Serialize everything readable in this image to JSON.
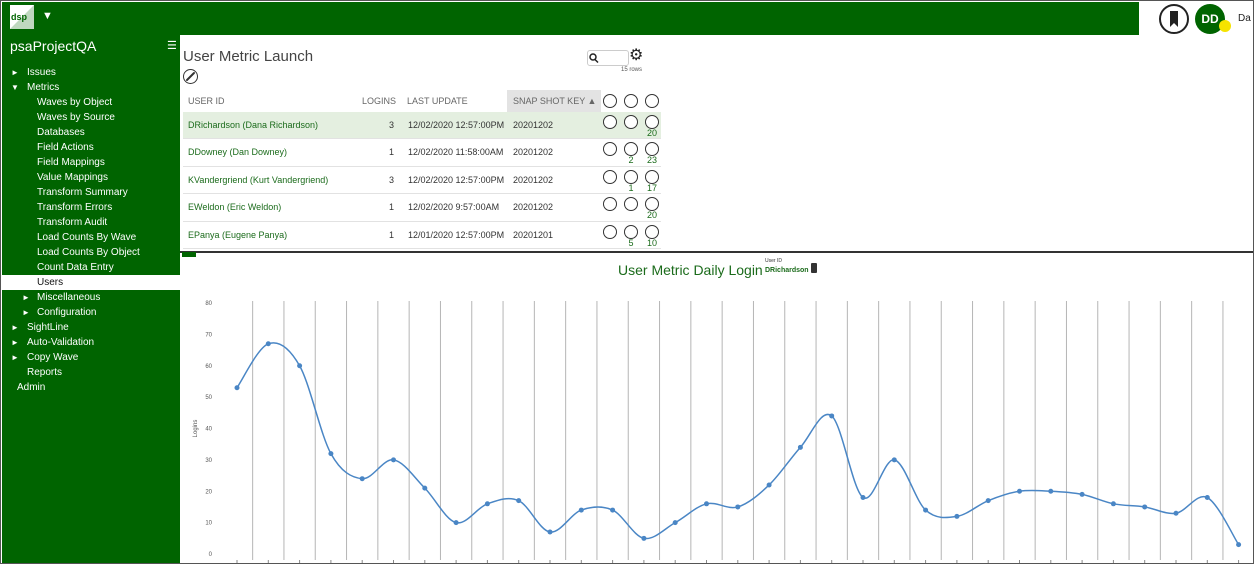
{
  "app": {
    "logo_text": "dsp",
    "user_initials": "DD",
    "user_name_short": "Da"
  },
  "sidebar": {
    "project": "psaProjectQA",
    "items": [
      {
        "label": "Issues",
        "arrow": "►",
        "level": 0
      },
      {
        "label": "Metrics",
        "arrow": "▼",
        "level": 0
      },
      {
        "label": "Waves by Object",
        "arrow": "",
        "level": 1
      },
      {
        "label": "Waves by Source",
        "arrow": "",
        "level": 1
      },
      {
        "label": "Databases",
        "arrow": "",
        "level": 1
      },
      {
        "label": "Field Actions",
        "arrow": "",
        "level": 1
      },
      {
        "label": "Field Mappings",
        "arrow": "",
        "level": 1
      },
      {
        "label": "Value Mappings",
        "arrow": "",
        "level": 1
      },
      {
        "label": "Transform Summary",
        "arrow": "",
        "level": 1
      },
      {
        "label": "Transform Errors",
        "arrow": "",
        "level": 1
      },
      {
        "label": "Transform Audit",
        "arrow": "",
        "level": 1
      },
      {
        "label": "Load Counts By Wave",
        "arrow": "",
        "level": 1
      },
      {
        "label": "Load Counts By Object",
        "arrow": "",
        "level": 1
      },
      {
        "label": "Count Data Entry",
        "arrow": "",
        "level": 1
      },
      {
        "label": "Users",
        "arrow": "",
        "level": 1,
        "active": true
      },
      {
        "label": "Miscellaneous",
        "arrow": "►",
        "level": 1
      },
      {
        "label": "Configuration",
        "arrow": "►",
        "level": 1
      },
      {
        "label": "SightLine",
        "arrow": "►",
        "level": 0
      },
      {
        "label": "Auto-Validation",
        "arrow": "►",
        "level": 0
      },
      {
        "label": "Copy Wave",
        "arrow": "►",
        "level": 0
      },
      {
        "label": "Reports",
        "arrow": "",
        "level": 0
      },
      {
        "label": "Admin",
        "arrow": "",
        "level": -1
      }
    ]
  },
  "page": {
    "title": "User Metric Launch",
    "rows_count": "15 rows"
  },
  "table": {
    "columns": {
      "user_id": "USER ID",
      "logins": "LOGINS",
      "last_update": "LAST UPDATE",
      "snap_shot_key": "SNAP SHOT KEY ▲"
    },
    "rows": [
      {
        "user": "DRichardson (Dana Richardson)",
        "logins": "3",
        "last_update": "12/02/2020 12:57:00PM",
        "snap": "20201202",
        "count_b": "",
        "count_c": "20",
        "selected": true
      },
      {
        "user": "DDowney (Dan Downey)",
        "logins": "1",
        "last_update": "12/02/2020 11:58:00AM",
        "snap": "20201202",
        "count_b": "2",
        "count_c": "23"
      },
      {
        "user": "KVandergriend (Kurt Vandergriend)",
        "logins": "3",
        "last_update": "12/02/2020 12:57:00PM",
        "snap": "20201202",
        "count_b": "1",
        "count_c": "17"
      },
      {
        "user": "EWeldon (Eric Weldon)",
        "logins": "1",
        "last_update": "12/02/2020 9:57:00AM",
        "snap": "20201202",
        "count_b": "",
        "count_c": "20"
      },
      {
        "user": "EPanya (Eugene Panya)",
        "logins": "1",
        "last_update": "12/01/2020 12:57:00PM",
        "snap": "20201201",
        "count_b": "5",
        "count_c": "10"
      }
    ]
  },
  "chart_section": {
    "title": "User Metric Daily Login",
    "filter_label": "User ID",
    "filter_value": "DRichardson"
  },
  "colors": {
    "brand_green": "#006400",
    "line": "#4a86c5",
    "avatar_dot": "#f5e300"
  },
  "chart_data": {
    "type": "line",
    "ylabel": "Logins",
    "ylim": [
      0,
      80
    ],
    "yticks": [
      0,
      10,
      20,
      30,
      40,
      50,
      60,
      70,
      80
    ],
    "grid": "vertical",
    "smooth": true,
    "series": [
      {
        "values": [
          53,
          67,
          60,
          32,
          24,
          30,
          21,
          10,
          16,
          17,
          7,
          14,
          14,
          5,
          10,
          16,
          15,
          22,
          34,
          44,
          18,
          30,
          14,
          12,
          17,
          20,
          20,
          19,
          16,
          15,
          13,
          18,
          3
        ]
      }
    ]
  }
}
